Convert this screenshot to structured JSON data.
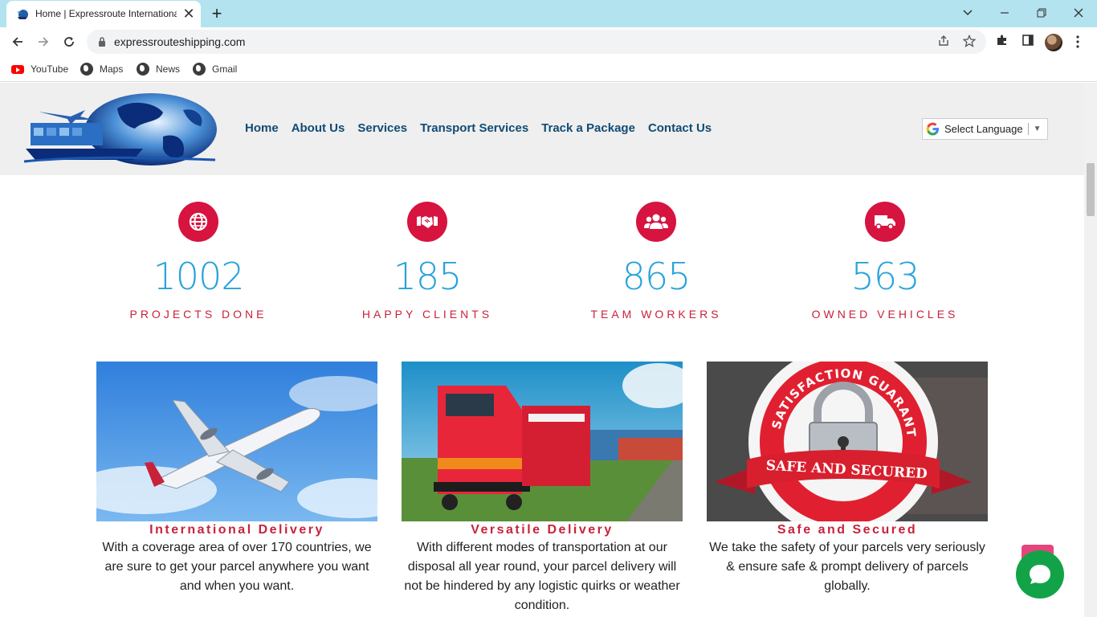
{
  "browser": {
    "tab_title": "Home | Expressroute International",
    "url": "expressrouteshipping.com",
    "tab_close_glyph": "✕",
    "new_tab_glyph": "+",
    "bookmarks": [
      {
        "label": "YouTube",
        "icon": "youtube-icon"
      },
      {
        "label": "Maps",
        "icon": "globe-icon"
      },
      {
        "label": "News",
        "icon": "globe-icon"
      },
      {
        "label": "Gmail",
        "icon": "globe-icon"
      }
    ]
  },
  "site": {
    "nav": [
      "Home",
      "About Us",
      "Services",
      "Transport Services",
      "Track a Package",
      "Contact Us"
    ],
    "language_select": "Select Language",
    "stats": [
      {
        "value": "1002",
        "label": "PROJECTS DONE",
        "icon": "globe-icon"
      },
      {
        "value": "185",
        "label": "HAPPY CLIENTS",
        "icon": "handshake-icon"
      },
      {
        "value": "865",
        "label": "TEAM WORKERS",
        "icon": "users-icon"
      },
      {
        "value": "563",
        "label": "OWNED VEHICLES",
        "icon": "truck-icon"
      }
    ],
    "cards": [
      {
        "title": "International Delivery",
        "text": "With a coverage area of over 170 countries, we are sure to get your parcel anywhere you want and when you want.",
        "image": "airplane-image"
      },
      {
        "title": "Versatile Delivery",
        "text": "With different modes of transportation at our disposal all year round, your parcel delivery will not be hindered by any logistic quirks or weather condition.",
        "image": "train-image"
      },
      {
        "title": "Safe and Secured",
        "text": "We take the safety of your parcels very seriously & ensure safe & prompt delivery of parcels globally.",
        "image": "safe-secured-badge-image",
        "badge_arc": "SATISFACTION GUARANTEED",
        "badge_banner": "SAFE AND SECURED"
      }
    ]
  },
  "colors": {
    "tab_strip": "#b3e3ee",
    "nav_link": "#114b75",
    "accent_red": "#d7133f",
    "stat_number": "#29a3da",
    "chat_green": "#12a349"
  }
}
